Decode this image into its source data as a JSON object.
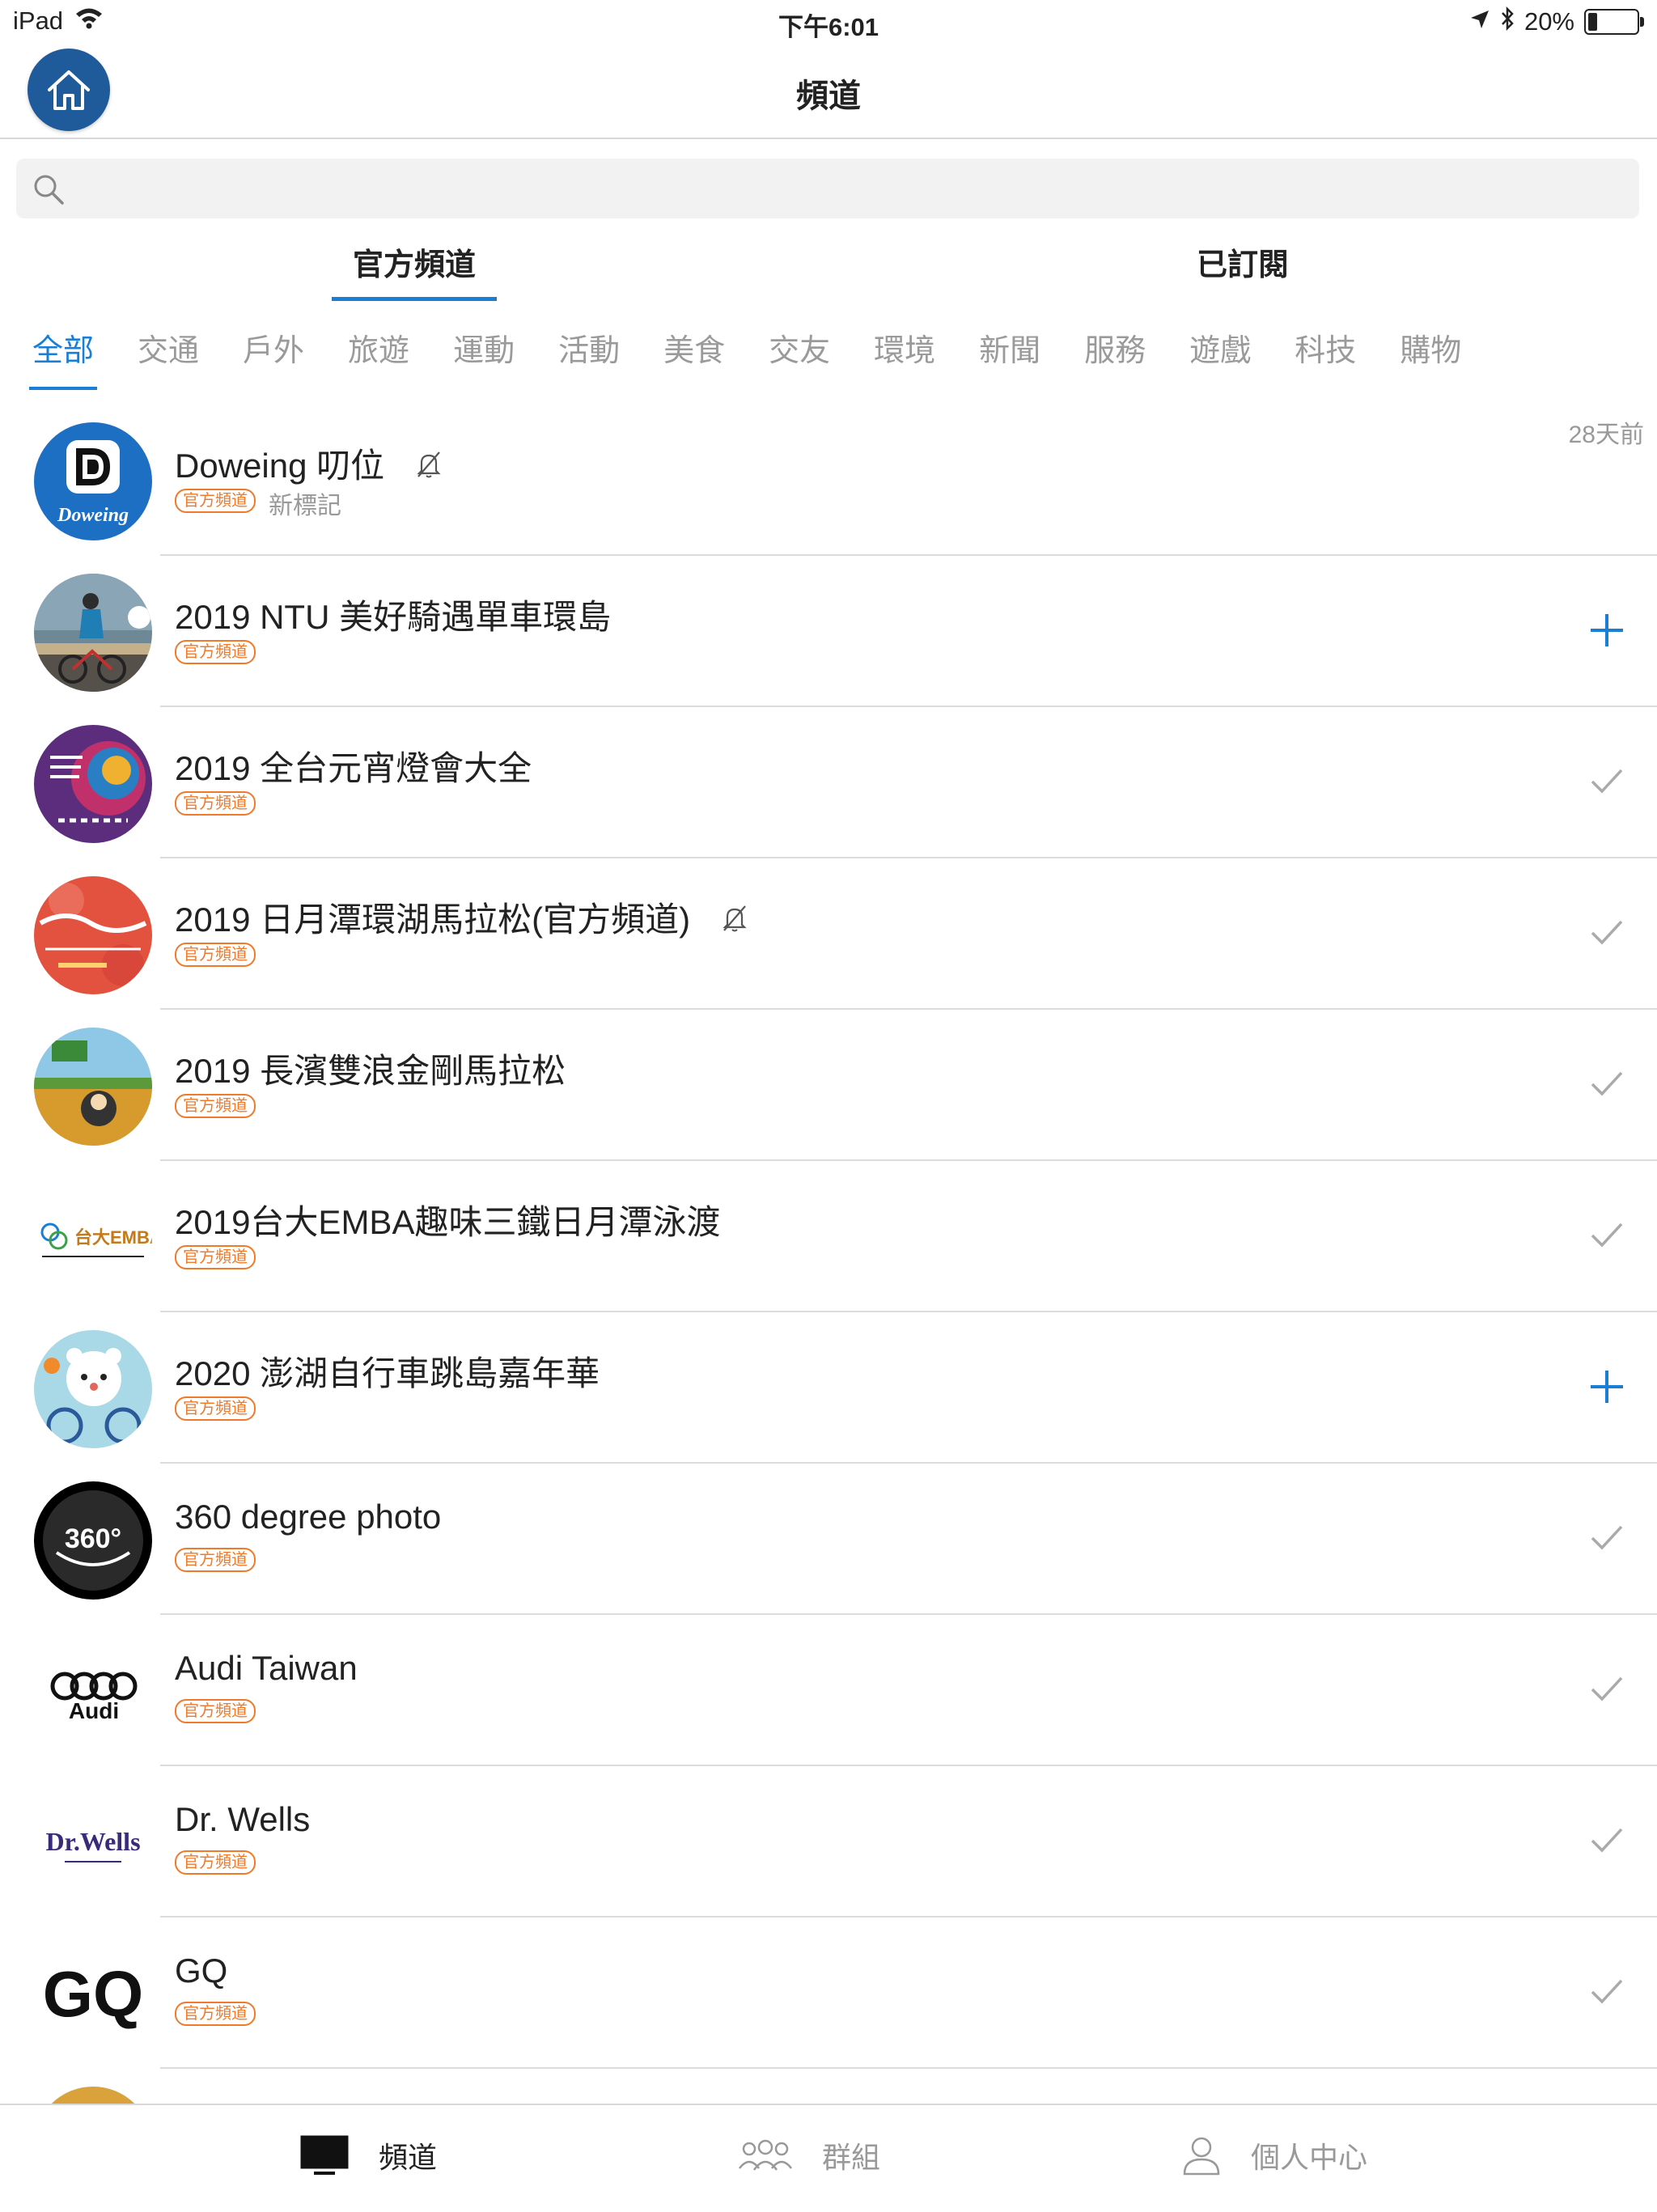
{
  "status_bar": {
    "device": "iPad",
    "time": "下午6:01",
    "battery": "20%",
    "battery_level": 0.2
  },
  "nav": {
    "title": "頻道"
  },
  "search": {
    "placeholder": ""
  },
  "segments": [
    {
      "label": "官方頻道",
      "active": true
    },
    {
      "label": "已訂閱",
      "active": false
    }
  ],
  "categories": [
    "全部",
    "交通",
    "戶外",
    "旅遊",
    "運動",
    "活動",
    "美食",
    "交友",
    "環境",
    "新聞",
    "服務",
    "遊戲",
    "科技",
    "購物"
  ],
  "official_badge": "官方頻道",
  "channels": [
    {
      "name": "Doweing 叨位",
      "tag": "新標記",
      "time": "28天前",
      "muted": true,
      "action": "none",
      "avatar": "doweing-logo"
    },
    {
      "name": "2019 NTU 美好騎遇單車環島",
      "action": "add",
      "avatar": "cycling-photo"
    },
    {
      "name": "2019 全台元宵燈會大全",
      "action": "check",
      "avatar": "lantern-festival-logo"
    },
    {
      "name": "2019 日月潭環湖馬拉松(官方頻道)",
      "muted": true,
      "action": "check",
      "avatar": "marathon-logo"
    },
    {
      "name": "2019 長濱雙浪金剛馬拉松",
      "action": "check",
      "avatar": "changbin-marathon-logo"
    },
    {
      "name": "2019台大EMBA趣味三鐵日月潭泳渡",
      "action": "check",
      "avatar": "emba-logo"
    },
    {
      "name": "2020 澎湖自行車跳島嘉年華",
      "action": "add",
      "avatar": "penghu-bear-logo"
    },
    {
      "name": "360 degree photo",
      "action": "check",
      "avatar": "360-logo"
    },
    {
      "name": "Audi Taiwan",
      "action": "check",
      "avatar": "audi-logo"
    },
    {
      "name": "Dr. Wells",
      "action": "check",
      "avatar": "drwells-logo"
    },
    {
      "name": "GQ",
      "action": "check",
      "avatar": "gq-logo"
    }
  ],
  "logo_text": {
    "doweing": "Doweing",
    "three_sixty": "360°",
    "audi": "Audi",
    "drwells": "Dr.Wells",
    "gq": "GQ",
    "emba": "台大EMBA"
  },
  "tab_bar": [
    {
      "label": "頻道",
      "icon": "monitor-icon",
      "active": true
    },
    {
      "label": "群組",
      "icon": "group-icon",
      "active": false
    },
    {
      "label": "個人中心",
      "icon": "person-icon",
      "active": false
    }
  ],
  "colors": {
    "accent": "#1a7fd4",
    "badge": "#f07a2a",
    "home_button": "#1f5b9a"
  }
}
